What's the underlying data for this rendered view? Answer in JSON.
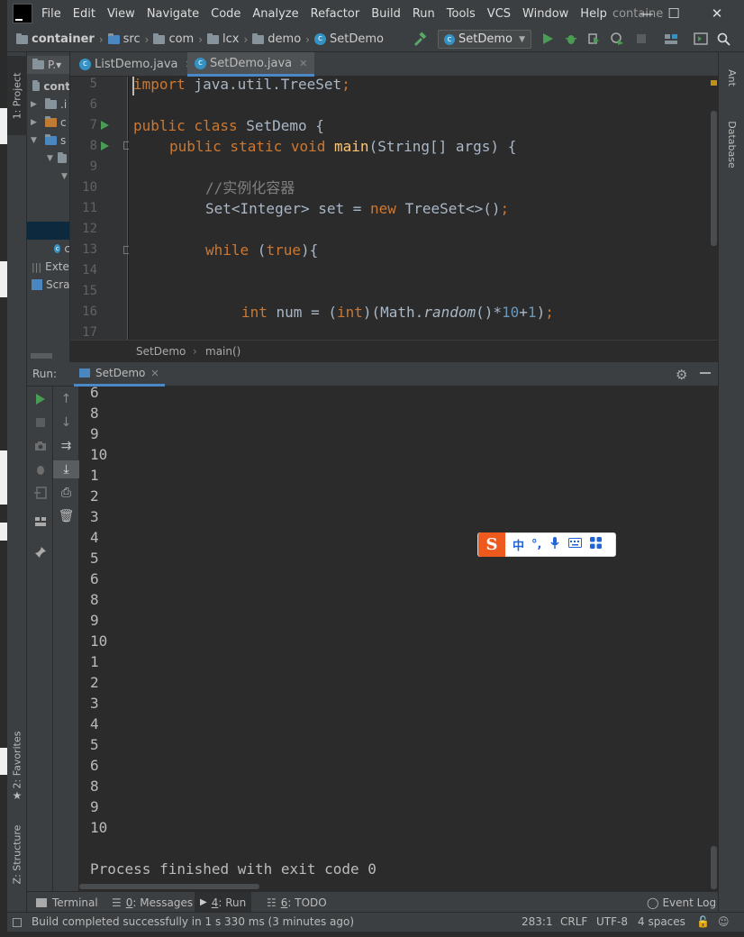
{
  "app": {
    "menu": [
      "File",
      "Edit",
      "View",
      "Navigate",
      "Code",
      "Analyze",
      "Refactor",
      "Build",
      "Run",
      "Tools",
      "VCS",
      "Window",
      "Help"
    ],
    "project_name_truncated": "containe",
    "window_controls": {
      "minimize": "—",
      "maximize": "☐",
      "close": "✕"
    }
  },
  "breadcrumbs": {
    "items": [
      "container",
      "src",
      "com",
      "lcx",
      "demo",
      "SetDemo"
    ],
    "separator": "›"
  },
  "toolbar": {
    "run_config": "SetDemo",
    "run_config_arrow": "▼"
  },
  "left_strip": {
    "project_tab": "1: Project",
    "favorites_tab": "2: Favorites",
    "structure_tab": "Z: Structure"
  },
  "right_strip": {
    "ant_tab": "Ant",
    "database_tab": "Database"
  },
  "project_panel": {
    "header": "P.▾",
    "root": "cont",
    "rows": [
      ".i",
      "c",
      "s",
      "",
      "",
      "",
      "c"
    ],
    "external_libs": "Exte",
    "scratches": "Scra"
  },
  "editor": {
    "tabs": [
      {
        "label": "ListDemo.java",
        "active": false
      },
      {
        "label": "SetDemo.java",
        "active": true
      }
    ],
    "line_numbers": [
      "5",
      "6",
      "7",
      "8",
      "9",
      "10",
      "11",
      "12",
      "13",
      "14",
      "15",
      "16",
      "17"
    ],
    "code": {
      "l5_kw": "import",
      "l5_rest": " java.util.TreeSet",
      "l5_semi": ";",
      "l7_kw": "public class",
      "l7_rest": " SetDemo {",
      "l8_kw": "public static void",
      "l8_fn": "main",
      "l8_rest": "(String[] args) {",
      "l10_comment": "//实例化容器",
      "l11_a": "Set<Integer> set = ",
      "l11_kw": "new",
      "l11_b": " TreeSet<>()",
      "l11_semi": ";",
      "l13_kw": "while",
      "l13_a": " (",
      "l13_true": "true",
      "l13_b": "){",
      "l16_kw": "int",
      "l16_a": " num = (",
      "l16_cast": "int",
      "l16_b": ")(Math.",
      "l16_random": "random",
      "l16_c": "()*",
      "l16_n1": "10",
      "l16_d": "+",
      "l16_n2": "1",
      "l16_e": ")",
      "l16_semi": ";"
    },
    "breadcrumb_class": "SetDemo",
    "breadcrumb_method": "main()"
  },
  "run_panel": {
    "label": "Run:",
    "tab": "SetDemo",
    "output_lines": [
      "6",
      "8",
      "9",
      "10",
      "1",
      "2",
      "3",
      "4",
      "5",
      "6",
      "8",
      "9",
      "10",
      "1",
      "2",
      "3",
      "4",
      "5",
      "6",
      "8",
      "9",
      "10"
    ],
    "exit_message": "Process finished with exit code 0"
  },
  "ime": {
    "logo": "S",
    "mode": "中",
    "punct": "°,"
  },
  "bottom_tabs": {
    "terminal": "Terminal",
    "messages_num": "0",
    "messages": ": Messages",
    "run_num": "4",
    "run": ": Run",
    "todo_num": "6",
    "todo": ": TODO",
    "event_log": "Event Log"
  },
  "statusbar": {
    "message": "Build completed successfully in 1 s 330 ms (3 minutes ago)",
    "position": "283:1",
    "line_sep": "CRLF",
    "encoding": "UTF-8",
    "indent": "4 spaces"
  },
  "colors": {
    "accent": "#4a88c7",
    "run_green": "#499c54",
    "keyword": "#cc7832",
    "function": "#ffc66d",
    "number": "#6897bb",
    "comment": "#808080"
  }
}
